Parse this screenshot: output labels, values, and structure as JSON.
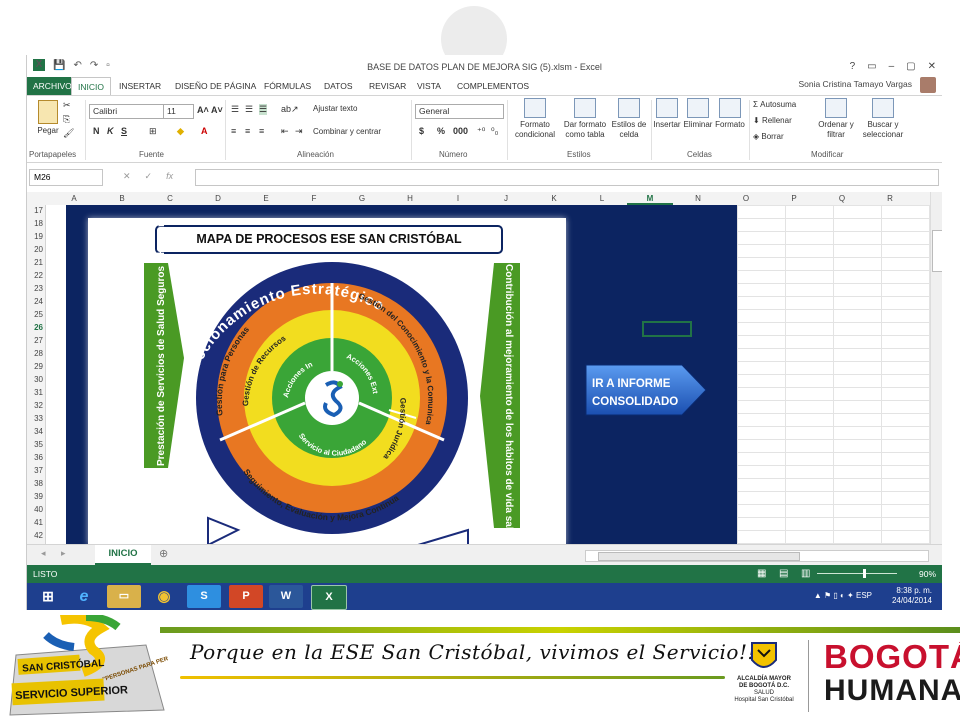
{
  "window": {
    "title": "BASE DE DATOS PLAN DE MEJORA SIG (5).xlsm - Excel",
    "user": "Sonia Cristina Tamayo Vargas",
    "controls": [
      "?",
      "▭",
      "–",
      "▢",
      "✕"
    ]
  },
  "tabs": [
    "ARCHIVO",
    "INICIO",
    "INSERTAR",
    "DISEÑO DE PÁGINA",
    "FÓRMULAS",
    "DATOS",
    "REVISAR",
    "VISTA",
    "COMPLEMENTOS"
  ],
  "ribbon": {
    "clipboard": {
      "paste": "Pegar",
      "label": "Portapapeles"
    },
    "font": {
      "name": "Calibri",
      "size": "11",
      "label": "Fuente",
      "bold": "N",
      "italic": "K",
      "underline": "S"
    },
    "alignment": {
      "wrap": "Ajustar texto",
      "merge": "Combinar y centrar",
      "label": "Alineación"
    },
    "number": {
      "format": "General",
      "label": "Número"
    },
    "styles": {
      "conditional": "Formato condicional",
      "table": "Dar formato como tabla",
      "cell_styles": "Estilos de celda",
      "label": "Estilos"
    },
    "cells": {
      "insert": "Insertar",
      "delete": "Eliminar",
      "format": "Formato",
      "label": "Celdas"
    },
    "editing": {
      "autosum": "Autosuma",
      "fill": "Rellenar",
      "clear": "Borrar",
      "sort": "Ordenar y filtrar",
      "find": "Buscar y seleccionar",
      "label": "Modificar"
    }
  },
  "formula_bar": {
    "name_box": "M26",
    "fx": "fx",
    "value": ""
  },
  "columns": [
    "A",
    "B",
    "C",
    "D",
    "E",
    "F",
    "G",
    "H",
    "I",
    "J",
    "K",
    "L",
    "M",
    "N",
    "O",
    "P",
    "Q",
    "R"
  ],
  "selected_column": "M",
  "rows": [
    "17",
    "18",
    "19",
    "20",
    "21",
    "22",
    "23",
    "24",
    "25",
    "26",
    "27",
    "28",
    "29",
    "30",
    "31",
    "32",
    "33",
    "34",
    "35",
    "36",
    "37",
    "38",
    "39",
    "40",
    "41",
    "42"
  ],
  "selected_row": "26",
  "map": {
    "title": "MAPA DE PROCESOS ESE SAN CRISTÓBAL",
    "left_arrow": "Prestación de Servicios de Salud Seguros y Humanizados",
    "right_arrow": "Contribución al mejoramiento de los hábitos de vida saludable de la comunidad",
    "outer_ring": "Direccionamiento Estratégico",
    "orange_ring": {
      "left": "Gestión para Personas",
      "right": "Gestión del Conocimiento y la Comunicación",
      "bottom": "Seguimiento, Evaluación y Mejora Continua"
    },
    "yellow_ring": {
      "left": "Gestión de Recursos",
      "right": "Gestión Jurídica"
    },
    "green_core": {
      "left": "Acciones Intramurales",
      "right": "Acciones Extramurales",
      "bottom": "Servicio al Ciudadano"
    }
  },
  "button": {
    "label_line1": "IR A INFORME",
    "label_line2": "CONSOLIDADO"
  },
  "sheet_tab": "INICIO",
  "status": {
    "ready": "LISTO",
    "zoom": "90%"
  },
  "taskbar": {
    "time": "8:38 p. m.",
    "date": "24/04/2014",
    "lang": "ESP"
  },
  "footer": {
    "slogan": "Porque en la ESE San Cristóbal, vivimos el Servicio!!!",
    "ese_logo_line1": "SAN CRISTÓBAL",
    "ese_logo_line2": "SERVICIO SUPERIOR",
    "ese_logo_ribbon": "\"PERSONAS PARA PERSONAS\"",
    "alcaldia_line1": "ALCALDÍA MAYOR",
    "alcaldia_line2": "DE BOGOTÁ D.C.",
    "alcaldia_line3": "SALUD",
    "alcaldia_line4": "Hospital San Cristóbal",
    "bogota": "BOGOTÁ",
    "humana": "HUMANA"
  },
  "colors": {
    "excel_green": "#217346",
    "navy": "#0c2461",
    "orange": "#e87722",
    "yellow": "#f2dd1f",
    "green": "#3aa537",
    "button_blue": "#2e6fd0"
  }
}
